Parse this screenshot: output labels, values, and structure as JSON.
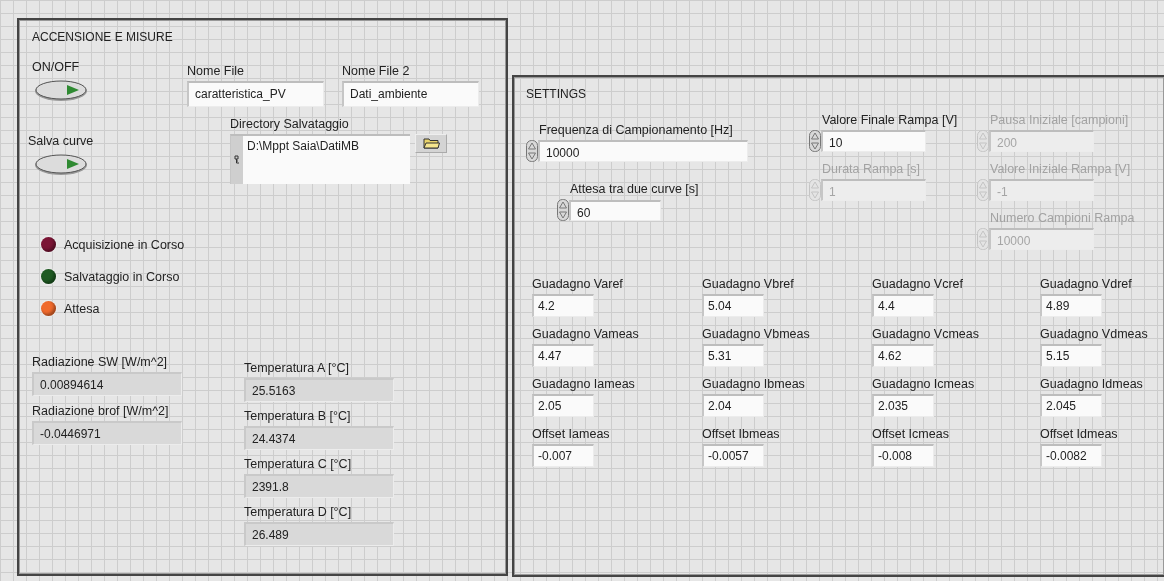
{
  "left_panel": {
    "title": "ACCENSIONE E MISURE",
    "switches": [
      {
        "label": "ON/OFF",
        "on": false
      },
      {
        "label": "Salva curve",
        "on": false
      }
    ],
    "file_fields": [
      {
        "label": "Nome File",
        "value": "caratteristica_PV"
      },
      {
        "label": "Nome File 2",
        "value": "Dati_ambiente"
      }
    ],
    "directory": {
      "label": "Directory Salvataggio",
      "value": "D:\\Mppt Saia\\DatiMB"
    },
    "leds": [
      {
        "label": "Acquisizione in Corso",
        "color": "#7b1535"
      },
      {
        "label": "Salvataggio in Corso",
        "color": "#1e5a22"
      },
      {
        "label": "Attesa",
        "color": "#f06a2c"
      }
    ],
    "radiation": [
      {
        "label": "Radiazione SW [W/m^2]",
        "value": "0.00894614"
      },
      {
        "label": "Radiazione brof [W/m^2]",
        "value": "-0.0446971"
      }
    ],
    "temperatures": [
      {
        "label": "Temperatura A [°C]",
        "value": "25.5163"
      },
      {
        "label": "Temperatura B [°C]",
        "value": "24.4374"
      },
      {
        "label": "Temperatura C [°C]",
        "value": "2391.8"
      },
      {
        "label": "Temperatura D [°C]",
        "value": "26.489"
      }
    ]
  },
  "settings_panel": {
    "title": "SETTINGS",
    "columns": [
      [
        {
          "label": "Frequenza di Campionamento [Hz]",
          "value": "10000",
          "disabled": false
        },
        {
          "label": "Attesa tra due curve [s]",
          "value": "60",
          "disabled": false
        }
      ],
      [
        {
          "label": "Valore Finale Rampa [V]",
          "value": "10",
          "disabled": false
        },
        {
          "label": "Durata Rampa [s]",
          "value": "1",
          "disabled": true
        }
      ],
      [
        {
          "label": "Pausa Iniziale [campioni]",
          "value": "200",
          "disabled": true
        },
        {
          "label": "Valore Iniziale Rampa [V]",
          "value": "-1",
          "disabled": true
        },
        {
          "label": "Numero Campioni Rampa",
          "value": "10000",
          "disabled": true
        }
      ]
    ],
    "gains": [
      {
        "label": "Guadagno Varef",
        "value": "4.2"
      },
      {
        "label": "Guadagno Vbref",
        "value": "5.04"
      },
      {
        "label": "Guadagno Vcref",
        "value": "4.4"
      },
      {
        "label": "Guadagno Vdref",
        "value": "4.89"
      },
      {
        "label": "Guadagno Vameas",
        "value": "4.47"
      },
      {
        "label": "Guadagno Vbmeas",
        "value": "5.31"
      },
      {
        "label": "Guadagno Vcmeas",
        "value": "4.62"
      },
      {
        "label": "Guadagno Vdmeas",
        "value": "5.15"
      },
      {
        "label": "Guadagno Iameas",
        "value": "2.05"
      },
      {
        "label": "Guadagno Ibmeas",
        "value": "2.04"
      },
      {
        "label": "Guadagno Icmeas",
        "value": "2.035"
      },
      {
        "label": "Guadagno Idmeas",
        "value": "2.045"
      },
      {
        "label": "Offset Iameas",
        "value": "-0.007"
      },
      {
        "label": "Offset Ibmeas",
        "value": "-0.0057"
      },
      {
        "label": "Offset Icmeas",
        "value": "-0.008"
      },
      {
        "label": "Offset Idmeas",
        "value": "-0.0082"
      }
    ]
  }
}
